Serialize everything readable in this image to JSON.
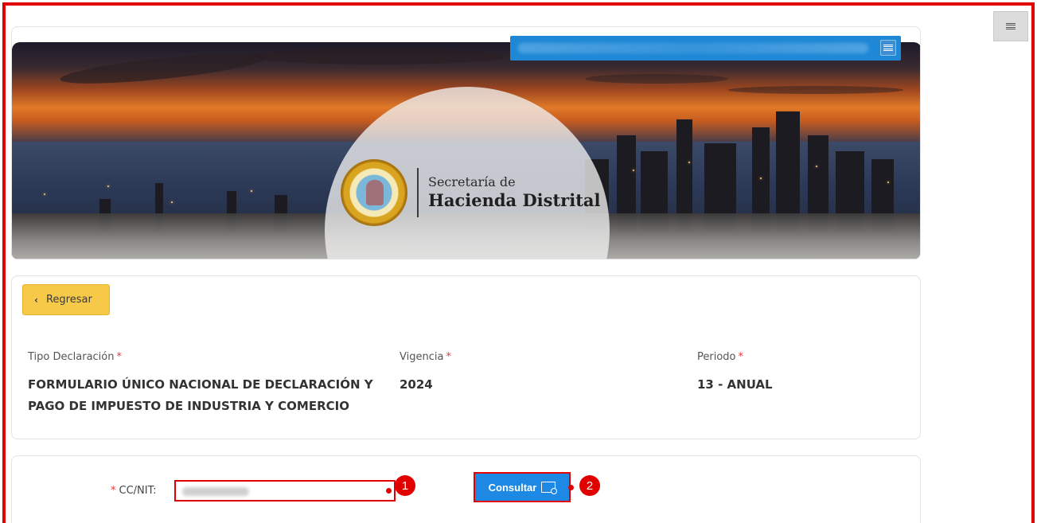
{
  "colors": {
    "frame": "#e00000",
    "primary": "#1e88e5",
    "back_button": "#f7c948",
    "required": "#e53935"
  },
  "banner": {
    "brand_line1": "Secretaría de",
    "brand_line2": "Hacienda Distrital",
    "seal_icon": "cartagena-seal-icon"
  },
  "top_menu": {
    "icon": "hamburger-icon"
  },
  "actions": {
    "back_label": "Regresar",
    "back_icon": "chevron-left-icon"
  },
  "declaration": {
    "tipo_label": "Tipo Declaración",
    "tipo_value": "FORMULARIO ÚNICO NACIONAL DE DECLARACIÓN Y PAGO DE IMPUESTO DE INDUSTRIA Y COMERCIO",
    "vigencia_label": "Vigencia",
    "vigencia_value": "2024",
    "periodo_label": "Periodo",
    "periodo_value": "13 - ANUAL",
    "required_mark": "*"
  },
  "search": {
    "cc_label": "CC/NIT:",
    "required_mark": "*",
    "consultar_label": "Consultar",
    "consultar_icon": "search-document-icon"
  },
  "annotations": {
    "marker1": "1",
    "marker2": "2"
  }
}
